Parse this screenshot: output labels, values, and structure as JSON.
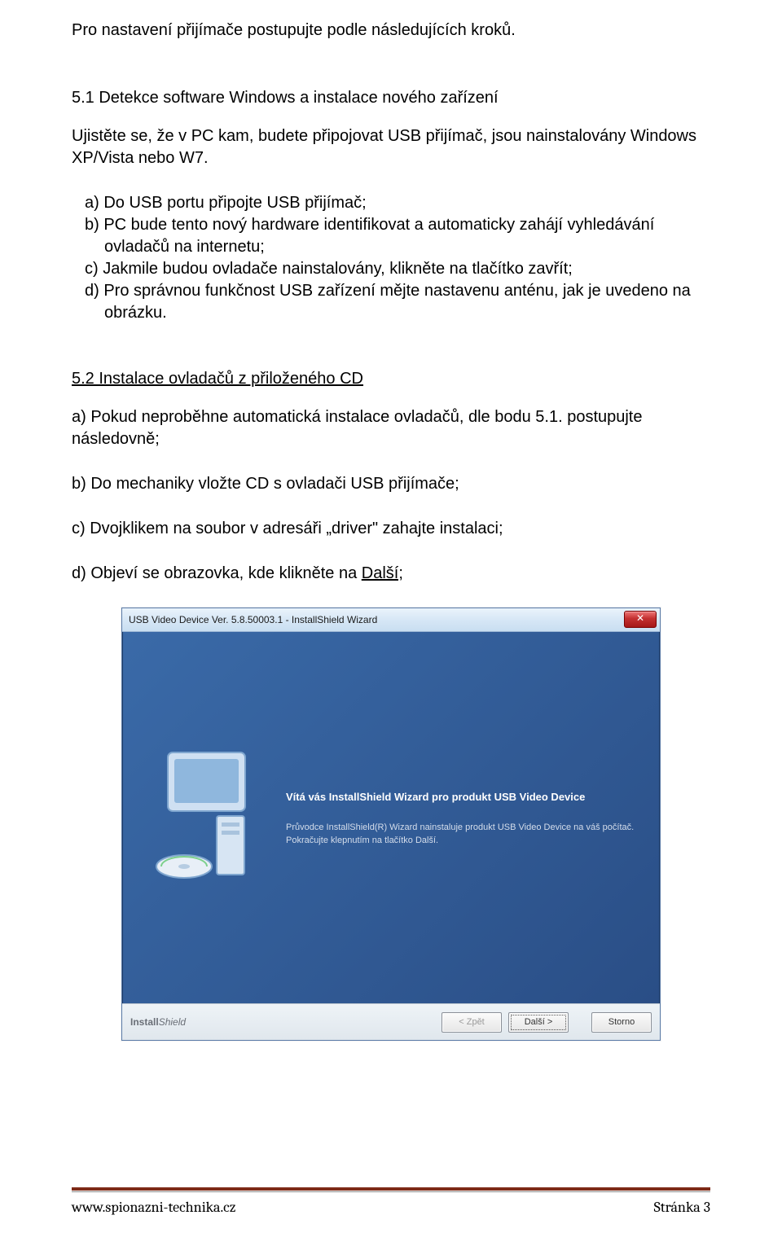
{
  "intro": "Pro nastavení přijímače postupujte podle následujících kroků.",
  "section51": {
    "title": "5.1 Detekce software Windows a instalace nového zařízení",
    "para": "Ujistěte se, že v PC kam, budete připojovat USB přijímač, jsou nainstalovány Windows XP/Vista nebo W7.",
    "items": {
      "a": "a)  Do USB portu připojte USB přijímač;",
      "b": "b)  PC bude tento nový hardware identifikovat a automaticky zahájí vyhledávání ovladačů na internetu;",
      "c": "c)  Jakmile budou ovladače nainstalovány, klikněte na tlačítko zavřít;",
      "d": "d)  Pro správnou funkčnost USB zařízení mějte nastavenu anténu, jak je uvedeno na obrázku."
    }
  },
  "section52": {
    "title": "5.2 Instalace ovladačů z přiloženého CD",
    "a": "a) Pokud neproběhne automatická instalace ovladačů, dle bodu 5.1. postupujte následovně;",
    "b": "b) Do mechaniky vložte CD s ovladači USB přijímače;",
    "c": "c) Dvojklikem na soubor v adresáři „driver\" zahajte instalaci;",
    "d_pre": "d) Objeví se obrazovka, kde klikněte na ",
    "d_link": "Další;"
  },
  "installer": {
    "title": "USB Video Device Ver. 5.8.50003.1 - InstallShield Wizard",
    "close_glyph": "✕",
    "heading": "Vítá vás InstallShield Wizard pro produkt USB Video Device",
    "line1": "Průvodce InstallShield(R) Wizard nainstaluje produkt USB Video Device na váš počítač.",
    "line2": "Pokračujte klepnutím na tlačítko Další.",
    "brand_bold": "Install",
    "brand_rest": "Shield",
    "btn_back": "< Zpět",
    "btn_next": "Další >",
    "btn_cancel": "Storno"
  },
  "footer": {
    "left": "www.spionazni-technika.cz",
    "right": "Stránka 3"
  }
}
